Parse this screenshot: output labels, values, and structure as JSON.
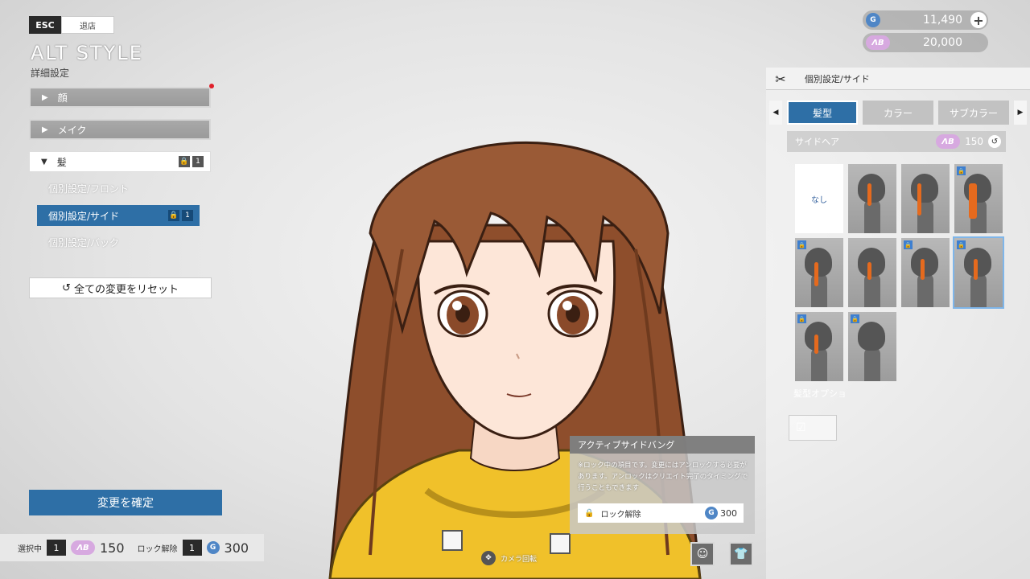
{
  "header": {
    "esc_label": "ESC",
    "exit_label": "退店",
    "title": "ALT STYLE",
    "subtitle": "詳細設定"
  },
  "categories": {
    "face": "顔",
    "makeup": "メイク",
    "hair": "髪",
    "hair_lock_count": "1"
  },
  "hair_submenu": {
    "front": "個別設定/フロント",
    "side": "個別設定/サイド",
    "side_lock_count": "1",
    "back": "個別設定/バック"
  },
  "reset_label": "全ての変更をリセット",
  "confirm_label": "変更を確定",
  "status": {
    "selected_label": "選択中",
    "selected_count": "1",
    "ab_icon": "ΛB",
    "ab_cost": "150",
    "unlock_label": "ロック解除",
    "unlock_count": "1",
    "coin_cost": "300"
  },
  "currency": {
    "coins": "11,490",
    "ab_points": "20,000"
  },
  "panel": {
    "header": "個別設定/サイド",
    "tabs": [
      "髪型",
      "カラー",
      "サブカラー"
    ],
    "section_label": "サイドヘア",
    "section_cost": "150",
    "none_label": "なし",
    "option_label": "髪型オプショ"
  },
  "tooltip": {
    "title": "アクティブサイドバング",
    "body": "※ロック中の項目です。変更にはアンロックする必要があります。アンロックはクリエイト完了のタイミングで行うこともできます",
    "unlock_label": "ロック解除",
    "price": "300"
  },
  "camera_label": "カメラ回転",
  "colors": {
    "accent": "#2e6fa6",
    "hair": "#9a5a36",
    "hoodie": "#f0c12a"
  }
}
